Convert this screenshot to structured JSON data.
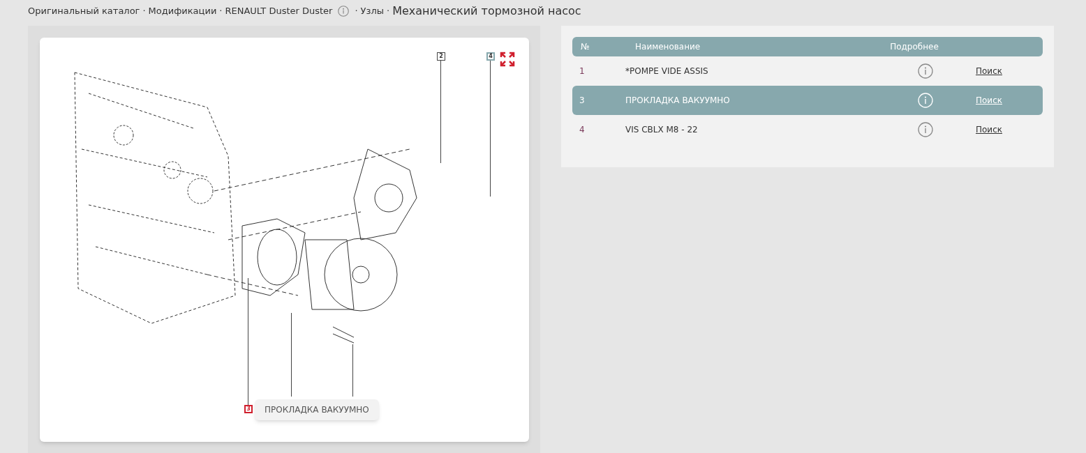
{
  "breadcrumb": {
    "items": [
      "Оригинальный каталог",
      "Модификации",
      "RENAULT Duster Duster",
      "Узлы"
    ],
    "current": "Механический тормозной насос",
    "separator": "·"
  },
  "diagram": {
    "callouts": [
      {
        "label": "2",
        "selected": false,
        "highlighted": false
      },
      {
        "label": "4",
        "selected": true,
        "highlighted": false
      },
      {
        "label": "3",
        "selected": false,
        "highlighted": true
      }
    ],
    "tooltip": "ПРОКЛАДКА ВАКУУМНО"
  },
  "table": {
    "columns": [
      "№",
      "Наименование",
      "Подробнее"
    ],
    "rows": [
      {
        "number": "1",
        "name": "*POMPE VIDE ASSIS",
        "link": "Поиск",
        "selected": false
      },
      {
        "number": "3",
        "name": "ПРОКЛАДКА ВАКУУМНО",
        "link": "Поиск",
        "selected": true
      },
      {
        "number": "4",
        "name": "VIS CBLX M8 - 22",
        "link": "Поиск",
        "selected": false
      }
    ]
  }
}
